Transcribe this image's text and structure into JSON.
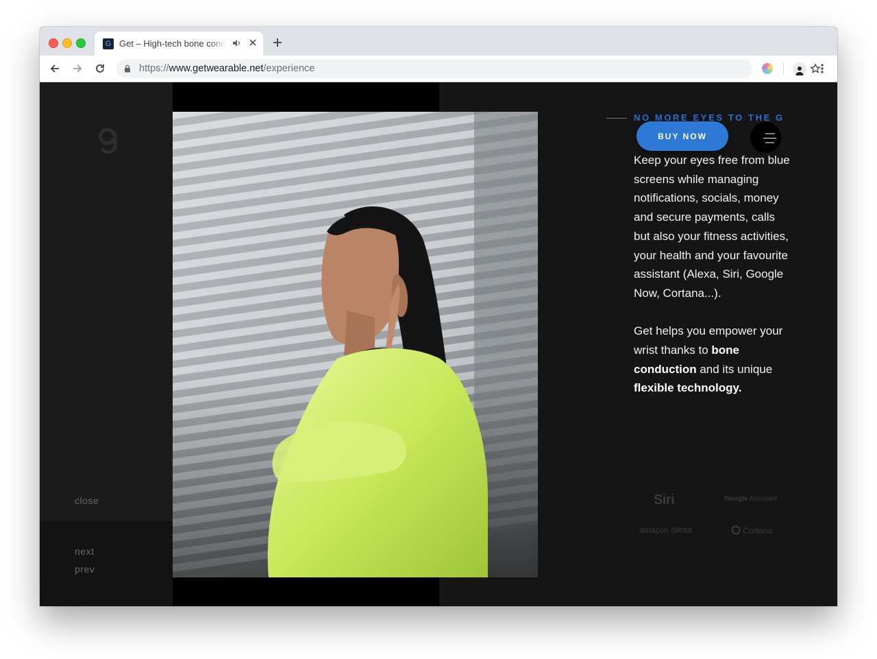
{
  "browser": {
    "tab_title": "Get – High-tech bone conduction",
    "url_scheme": "https://",
    "url_host": "www.getwearable.net",
    "url_path": "/experience",
    "favicon_letter": "G"
  },
  "site": {
    "left_nav": {
      "close": "close",
      "next": "next",
      "prev": "prev"
    },
    "eyebrow": "NO MORE EYES TO THE G",
    "buy_button": "BUY NOW",
    "paragraph1": "Keep your eyes free from blue screens while managing notifications, socials, money and secure payments, calls but also your fitness activities, your health and your favourite assistant (Alexa, Siri, Google Now, Cortana...).",
    "paragraph2_start": "Get helps you empower your wrist thanks to ",
    "paragraph2_bold1": "bone conduction",
    "paragraph2_mid": " and its unique",
    "paragraph2_bold2": "flexible technology.",
    "assistants": {
      "siri": "Siri",
      "google_brand": "Google",
      "google_rest": " Assistant",
      "amazon": "amazon",
      "alexa": "alexa",
      "cortana": "Cortana"
    },
    "colors": {
      "accent": "#2e78d6",
      "background": "#151515"
    }
  }
}
